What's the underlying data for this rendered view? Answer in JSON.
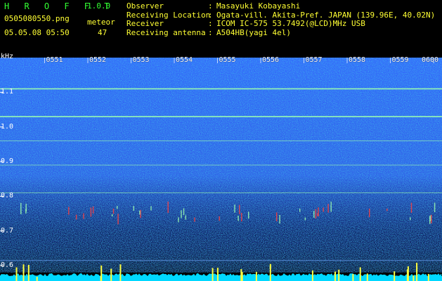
{
  "app": {
    "name": "H R O F F T",
    "version": "1.0.0"
  },
  "file": {
    "name": "0505080550.png",
    "date_time": "05.05.08 05:50"
  },
  "meteor": {
    "label": "meteor",
    "count": "47"
  },
  "info": [
    {
      "key": "Observer",
      "sep": ":",
      "value": "Masayuki Kobayashi"
    },
    {
      "key": "Receiving Location",
      "sep": ":",
      "value": "Ogata-vill. Akita-Pref. JAPAN (139.96E, 40.02N)"
    },
    {
      "key": "Receiver",
      "sep": ":",
      "value": "ICOM IC-575 53.7492(@LCD)MHz USB"
    },
    {
      "key": "Receiving antenna",
      "sep": ":",
      "value": "A504HB(yagi 4el)"
    }
  ],
  "spectrogram": {
    "unit": "kHz",
    "x_ticks": [
      "0551",
      "0552",
      "0553",
      "0554",
      "0555",
      "0556",
      "0557",
      "0558",
      "0559",
      "0600"
    ],
    "y_ticks": [
      "1.1",
      "1.0",
      "0.9",
      "0.8",
      "0.7",
      "0.6"
    ],
    "y_tick_values": [
      1.1,
      1.0,
      0.9,
      0.8,
      0.7,
      0.6
    ],
    "x_range": [
      "0550",
      "0600"
    ],
    "y_range_khz": [
      0.58,
      1.2
    ],
    "carrier_lines_khz": [
      1.11,
      1.03,
      0.96,
      0.89,
      0.81
    ],
    "colors": {
      "background": "#000000",
      "noise_low": "#0a1a8c",
      "noise_high": "#3060ff",
      "carrier": "#9cffb0",
      "meteor_ping": "#ffff40",
      "baseline": "#00d8ff",
      "grid_tick": "#ffffff"
    }
  }
}
